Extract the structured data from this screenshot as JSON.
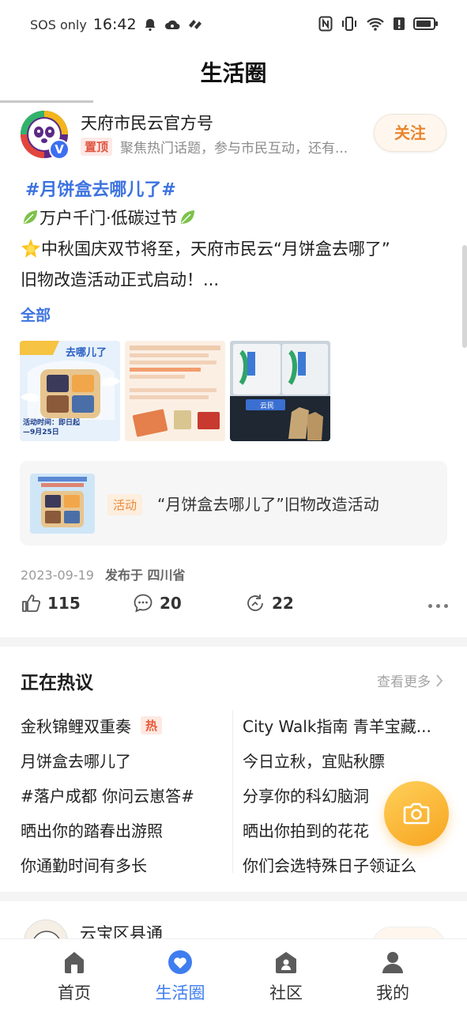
{
  "status_bar": {
    "carrier": "SOS only",
    "time": "16:42"
  },
  "header": {
    "title": "生活圈"
  },
  "post": {
    "author_name": "天府市民云官方号",
    "pin_label": "置顶",
    "author_desc": "聚焦热门话题，参与市民互动，还有...",
    "follow_label": "关注",
    "topic": "#月饼盒去哪儿了#",
    "line1": "万户千门·低碳过节",
    "line2": "中秋国庆双节将至，天府市民云“月饼盒去哪了”",
    "line3": "旧物改造活动正式启动！...",
    "full_label": "全部",
    "activity_badge": "活动",
    "activity_title": "“月饼盒去哪儿了”旧物改造活动",
    "date": "2023-09-19",
    "location": "发布于 四川省",
    "likes": "115",
    "comments": "20",
    "shares": "22",
    "thumb1_text": "去哪儿了",
    "thumb1_caption": "活动时间：即日起—9月25日",
    "thumb3_caption": "云民"
  },
  "hot": {
    "title": "正在热议",
    "see_more": "查看更多",
    "hot_tag": "热",
    "left": [
      "金秋锦鲤双重奏",
      "月饼盒去哪儿了",
      "#落户成都 你问云崽答#",
      "晒出你的踏春出游照",
      "你通勤时间有多长"
    ],
    "right": [
      "City Walk指南 青羊宝藏...",
      "今日立秋，宜贴秋膘",
      "分享你的科幻脑洞",
      "晒出你拍到的花花",
      "你们会选特殊日子领证么"
    ]
  },
  "next_post": {
    "author_name": "云宝区县通"
  },
  "nav": {
    "items": [
      {
        "label": "首页"
      },
      {
        "label": "生活圈"
      },
      {
        "label": "社区"
      },
      {
        "label": "我的"
      }
    ],
    "active_color": "#3f7df0"
  }
}
